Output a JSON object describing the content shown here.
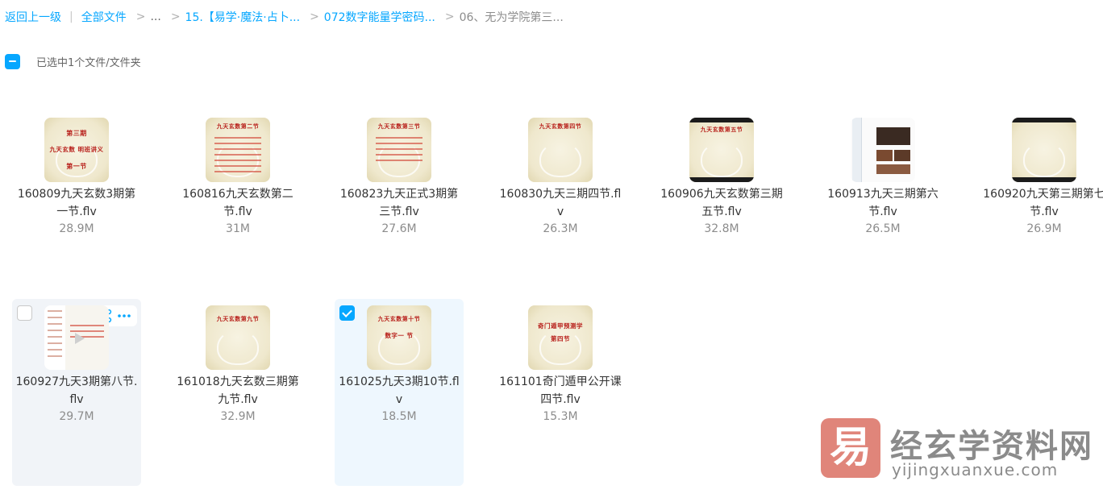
{
  "breadcrumb": {
    "back": "返回上一级",
    "all_files": "全部文件",
    "ellipsis": "...",
    "level1": "15.【易学·魔法·占卜...",
    "level2": "072数字能量学密码...",
    "current": "06、无为学院第三...",
    "separator": ">",
    "pipe": "|"
  },
  "selection": {
    "text": "已选中1个文件/文件夹"
  },
  "files": [
    {
      "name": "160809九天玄数3期第一节.flv",
      "size": "28.9M",
      "thumb_title": "第三期",
      "thumb_sub": "九天玄数 明班讲义",
      "thumb_foot": "第一节"
    },
    {
      "name": "160816九天玄数第二节.flv",
      "size": "31M",
      "thumb_title": "九天玄数第二节"
    },
    {
      "name": "160823九天正式3期第三节.flv",
      "size": "27.6M",
      "thumb_title": "九天玄数第三节"
    },
    {
      "name": "160830九天三期四节.flv",
      "size": "26.3M",
      "thumb_title": "九天玄数第四节"
    },
    {
      "name": "160906九天玄数第三期五节.flv",
      "size": "32.8M",
      "thumb_title": "九天玄数第五节"
    },
    {
      "name": "160913九天三期第六节.flv",
      "size": "26.5M"
    },
    {
      "name": "160920九天第三期第七节.flv",
      "size": "26.9M"
    },
    {
      "name": "160927九天3期第八节.flv",
      "size": "29.7M"
    },
    {
      "name": "161018九天玄数三期第九节.flv",
      "size": "32.9M",
      "thumb_title": "九天玄数第九节"
    },
    {
      "name": "161025九天3期10节.flv",
      "size": "18.5M",
      "thumb_title": "九天玄数第十节",
      "thumb_sub": "数字一 节"
    },
    {
      "name": "161101奇门遁甲公开课四节.flv",
      "size": "15.3M",
      "thumb_title": "奇门遁甲预测学",
      "thumb_sub": "第四节"
    }
  ],
  "icons": {
    "phone": "mobile-icon",
    "share": "share-icon",
    "more": "more-icon",
    "checkbox": "checkbox-icon"
  },
  "colors": {
    "accent": "#06a7ff",
    "hover_bg": "#f1f4f8",
    "selected_bg": "#eef7fe"
  },
  "watermark": {
    "logo_char": "易",
    "cn": "经玄学资料网",
    "en": "yijingxuanxue.com"
  }
}
